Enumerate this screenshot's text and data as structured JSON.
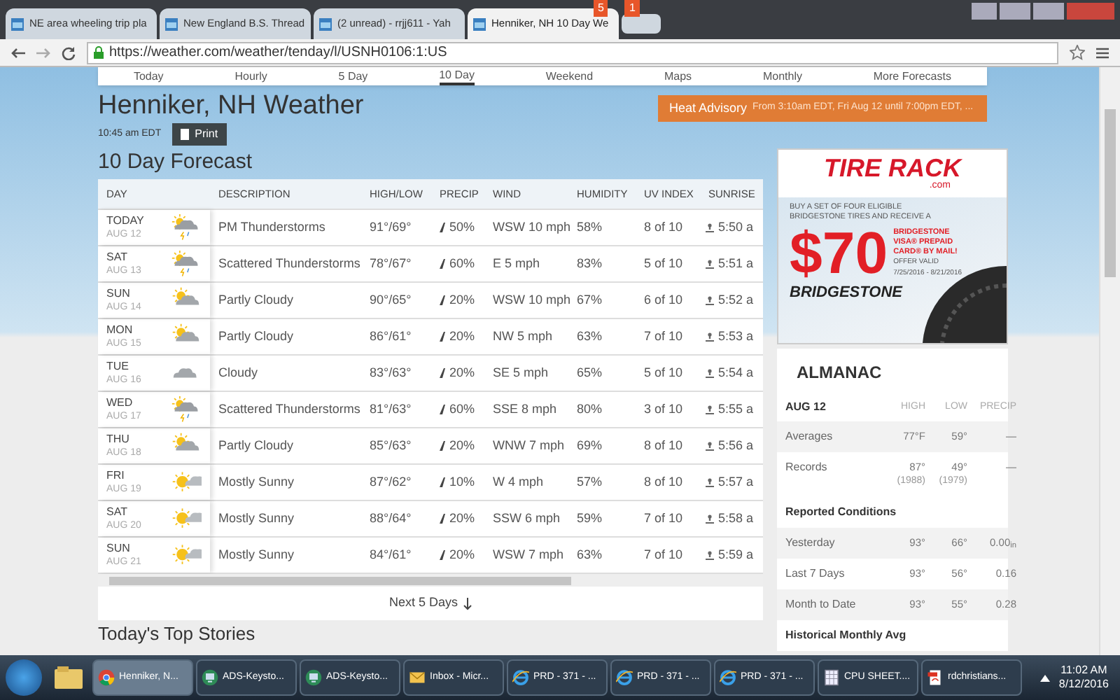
{
  "browser": {
    "tabs": [
      {
        "title": "NE area wheeling trip pla",
        "selected": false
      },
      {
        "title": "New England B.S. Thread",
        "selected": false
      },
      {
        "title": "(2 unread) - rrjj611 - Yah",
        "selected": false
      },
      {
        "title": "Henniker, NH 10 Day We",
        "selected": true
      }
    ],
    "badges": [
      "5",
      "1"
    ],
    "url": "https://weather.com/weather/tenday/l/USNH0106:1:US"
  },
  "nav": [
    {
      "label": "Today",
      "selected": false
    },
    {
      "label": "Hourly",
      "selected": false
    },
    {
      "label": "5 Day",
      "selected": false
    },
    {
      "label": "10 Day",
      "selected": true
    },
    {
      "label": "Weekend",
      "selected": false
    },
    {
      "label": "Maps",
      "selected": false
    },
    {
      "label": "Monthly",
      "selected": false
    },
    {
      "label": "More Forecasts",
      "selected": false
    }
  ],
  "location_title": "Henniker, NH Weather",
  "updated": "10:45 am EDT",
  "print_button": "Print",
  "alert": {
    "title": "Heat Advisory",
    "detail": "From 3:10am EDT, Fri Aug 12 until 7:00pm EDT, ..."
  },
  "forecast": {
    "title": "10 Day Forecast",
    "columns": [
      "DAY",
      "DESCRIPTION",
      "HIGH/LOW",
      "PRECIP",
      "WIND",
      "HUMIDITY",
      "UV INDEX",
      "SUNRISE"
    ],
    "rows": [
      {
        "day": "TODAY",
        "date": "AUG 12",
        "kind": "storm",
        "description": "PM Thunderstorms",
        "high_low": "91°/69°",
        "precip": "50%",
        "wind": "WSW 10 mph",
        "humidity": "58%",
        "uv": "8 of 10",
        "sunrise": "5:50 a"
      },
      {
        "day": "SAT",
        "date": "AUG 13",
        "kind": "storm",
        "description": "Scattered Thunderstorms",
        "high_low": "78°/67°",
        "precip": "60%",
        "wind": "E 5 mph",
        "humidity": "83%",
        "uv": "5 of 10",
        "sunrise": "5:51 a"
      },
      {
        "day": "SUN",
        "date": "AUG 14",
        "kind": "partly",
        "description": "Partly Cloudy",
        "high_low": "90°/65°",
        "precip": "20%",
        "wind": "WSW 10 mph",
        "humidity": "67%",
        "uv": "6 of 10",
        "sunrise": "5:52 a"
      },
      {
        "day": "MON",
        "date": "AUG 15",
        "kind": "partly",
        "description": "Partly Cloudy",
        "high_low": "86°/61°",
        "precip": "20%",
        "wind": "NW 5 mph",
        "humidity": "63%",
        "uv": "7 of 10",
        "sunrise": "5:53 a"
      },
      {
        "day": "TUE",
        "date": "AUG 16",
        "kind": "cloudy",
        "description": "Cloudy",
        "high_low": "83°/63°",
        "precip": "20%",
        "wind": "SE 5 mph",
        "humidity": "65%",
        "uv": "5 of 10",
        "sunrise": "5:54 a"
      },
      {
        "day": "WED",
        "date": "AUG 17",
        "kind": "storm",
        "description": "Scattered Thunderstorms",
        "high_low": "81°/63°",
        "precip": "60%",
        "wind": "SSE 8 mph",
        "humidity": "80%",
        "uv": "3 of 10",
        "sunrise": "5:55 a"
      },
      {
        "day": "THU",
        "date": "AUG 18",
        "kind": "partly",
        "description": "Partly Cloudy",
        "high_low": "85°/63°",
        "precip": "20%",
        "wind": "WNW 7 mph",
        "humidity": "69%",
        "uv": "8 of 10",
        "sunrise": "5:56 a"
      },
      {
        "day": "FRI",
        "date": "AUG 19",
        "kind": "sunny",
        "description": "Mostly Sunny",
        "high_low": "87°/62°",
        "precip": "10%",
        "wind": "W 4 mph",
        "humidity": "57%",
        "uv": "8 of 10",
        "sunrise": "5:57 a"
      },
      {
        "day": "SAT",
        "date": "AUG 20",
        "kind": "sunny",
        "description": "Mostly Sunny",
        "high_low": "88°/64°",
        "precip": "20%",
        "wind": "SSW 6 mph",
        "humidity": "59%",
        "uv": "7 of 10",
        "sunrise": "5:58 a"
      },
      {
        "day": "SUN",
        "date": "AUG 21",
        "kind": "sunny",
        "description": "Mostly Sunny",
        "high_low": "84°/61°",
        "precip": "20%",
        "wind": "WSW 7 mph",
        "humidity": "63%",
        "uv": "7 of 10",
        "sunrise": "5:59 a"
      }
    ],
    "more": "Next 5 Days"
  },
  "stories_title": "Today's Top Stories",
  "ad": {
    "brand": "TIRE RACK",
    "domain": ".com",
    "offer": "BUY A SET OF FOUR ELIGIBLE BRIDGESTONE TIRES AND RECEIVE A",
    "amount": "$70",
    "card": "BRIDGESTONE VISA® PREPAID CARD® BY MAIL!",
    "valid": "OFFER VALID",
    "dates": "7/25/2016 - 8/21/2016",
    "maker": "BRIDGESTONE"
  },
  "almanac": {
    "title": "ALMANAC",
    "date": "AUG 12",
    "columns": [
      "HIGH",
      "LOW",
      "PRECIP"
    ],
    "groups": [
      {
        "rows": [
          {
            "label": "Averages",
            "high": "77°F",
            "low": "59°",
            "precip": "—"
          },
          {
            "label": "Records",
            "high": "87°",
            "low": "49°",
            "precip": "—",
            "high_note": "(1988)",
            "low_note": "(1979)"
          }
        ]
      },
      {
        "title": "Reported Conditions",
        "rows": [
          {
            "label": "Yesterday",
            "high": "93°",
            "low": "66°",
            "precip": "0.00$_{in}$"
          },
          {
            "label": "Last 7 Days",
            "high": "93°",
            "low": "56°",
            "precip": "0.16"
          },
          {
            "label": "Month to Date",
            "high": "93°",
            "low": "55°",
            "precip": "0.28"
          }
        ]
      },
      {
        "title": "Historical Monthly Avg"
      }
    ]
  },
  "taskbar": {
    "items": [
      {
        "kind": "folder",
        "selected": false
      },
      {
        "kind": "chrome",
        "label": "Henniker, N...",
        "selected": true
      },
      {
        "kind": "remote",
        "label": "ADS-Keysto...",
        "selected": false
      },
      {
        "kind": "remote",
        "label": "ADS-Keysto...",
        "selected": false
      },
      {
        "kind": "mail",
        "label": "Inbox - Micr...",
        "selected": false
      },
      {
        "kind": "ie",
        "label": "PRD - 371 - ...",
        "selected": false
      },
      {
        "kind": "ie",
        "label": "PRD - 371 - ...",
        "selected": false
      },
      {
        "kind": "ie",
        "label": "PRD - 371 - ...",
        "selected": false
      },
      {
        "kind": "sheet",
        "label": "CPU SHEET....",
        "selected": false
      },
      {
        "kind": "pdf",
        "label": "rdchristians...",
        "selected": false
      }
    ],
    "time": "11:02 AM",
    "date": "8/12/2016"
  }
}
